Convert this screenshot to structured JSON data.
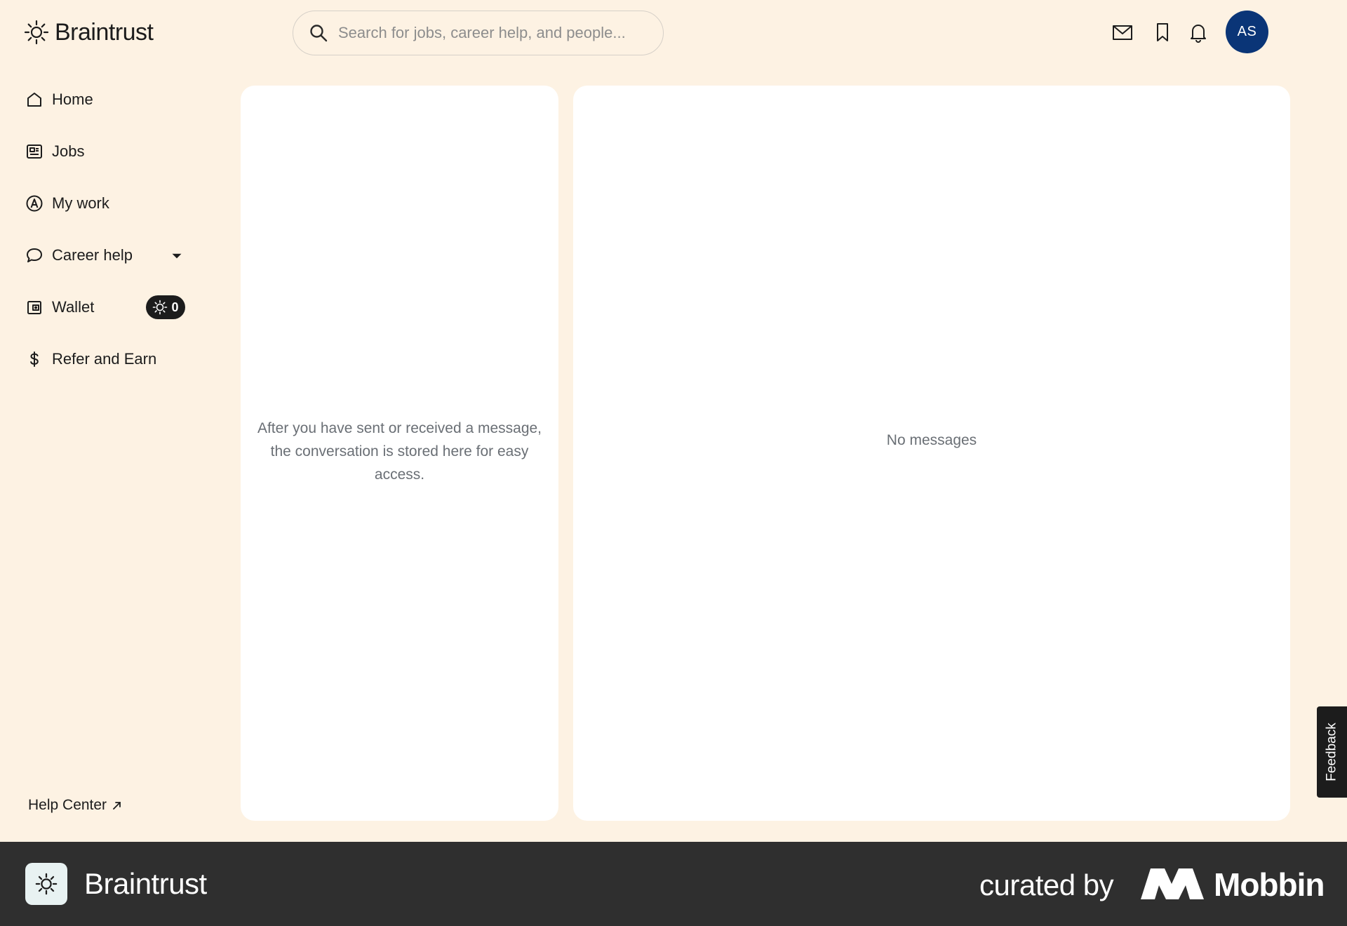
{
  "brand": {
    "name": "Braintrust"
  },
  "header": {
    "search_placeholder": "Search for jobs, career help, and people...",
    "icons": [
      "mail-icon",
      "bookmark-icon",
      "bell-icon"
    ],
    "avatar_initials": "AS",
    "avatar_color": "#0a3577"
  },
  "sidebar": {
    "items": [
      {
        "label": "Home",
        "icon": "home-icon"
      },
      {
        "label": "Jobs",
        "icon": "jobs-icon"
      },
      {
        "label": "My work",
        "icon": "my-work-icon"
      },
      {
        "label": "Career help",
        "icon": "chat-bubble-icon",
        "has_dropdown": true
      },
      {
        "label": "Wallet",
        "icon": "wallet-icon",
        "badge": "0"
      },
      {
        "label": "Refer and Earn",
        "icon": "dollar-icon"
      }
    ],
    "help_center": "Help Center"
  },
  "conversations": {
    "empty_text": "After you have sent or received a message, the conversation is stored here for easy access."
  },
  "messages": {
    "empty_text": "No messages"
  },
  "feedback_tab": "Feedback",
  "footer": {
    "brand": "Braintrust",
    "curated_by": "curated by",
    "mobbin": "Mobbin"
  },
  "colors": {
    "background": "#fdf2e3",
    "panel": "#ffffff",
    "footer": "#2f2f2f",
    "text_muted": "#6a6f75"
  }
}
